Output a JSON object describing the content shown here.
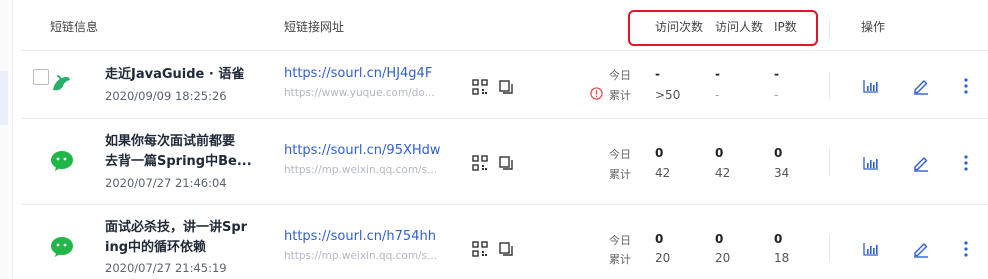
{
  "headers": {
    "info": "短链信息",
    "url": "短链接网址",
    "visits": "访问次数",
    "visitors": "访问人数",
    "ip": "IP数",
    "ops": "操作"
  },
  "rows": [
    {
      "title_line1": "走近JavaGuide · 语雀",
      "title_line2": "",
      "date": "2020/09/09 18:25:26",
      "short_url": "https://sourl.cn/HJ4g4F",
      "orig_url": "https://www.yuque.com/do...",
      "today_label": "今日",
      "total_label": "累计",
      "visits_today": "-",
      "visitors_today": "-",
      "ip_today": "-",
      "visits_total": ">50",
      "visitors_total": "-",
      "ip_total": "-"
    },
    {
      "title_line1": "如果你每次面试前都要",
      "title_line2": "去背一篇Spring中Be...",
      "date": "2020/07/27 21:46:04",
      "short_url": "https://sourl.cn/95XHdw",
      "orig_url": "https://mp.weixin.qq.com/s...",
      "today_label": "今日",
      "total_label": "累计",
      "visits_today": "0",
      "visitors_today": "0",
      "ip_today": "0",
      "visits_total": "42",
      "visitors_total": "42",
      "ip_total": "34"
    },
    {
      "title_line1": "面试必杀技，讲一讲Spr",
      "title_line2": "ing中的循环依赖",
      "date": "2020/07/27 21:45:19",
      "short_url": "https://sourl.cn/h754hh",
      "orig_url": "https://mp.weixin.qq.com/s...",
      "today_label": "今日",
      "total_label": "累计",
      "visits_today": "0",
      "visitors_today": "0",
      "ip_today": "0",
      "visits_total": "20",
      "visitors_total": "20",
      "ip_total": "18"
    }
  ],
  "icons": {
    "row1_source": "yuque-bird-icon",
    "row2_source": "wechat-icon",
    "row3_source": "wechat-icon",
    "warning": "warning-circle-icon",
    "qr": "qr-code-icon",
    "copy": "copy-icon",
    "stats": "bar-chart-icon",
    "edit": "pencil-icon",
    "more": "more-vertical-icon"
  },
  "colors": {
    "link": "#2f5fd0",
    "highlight_box": "#e0142a",
    "wechat": "#20b648",
    "yuque": "#29b16a",
    "warning": "#e5484d"
  }
}
